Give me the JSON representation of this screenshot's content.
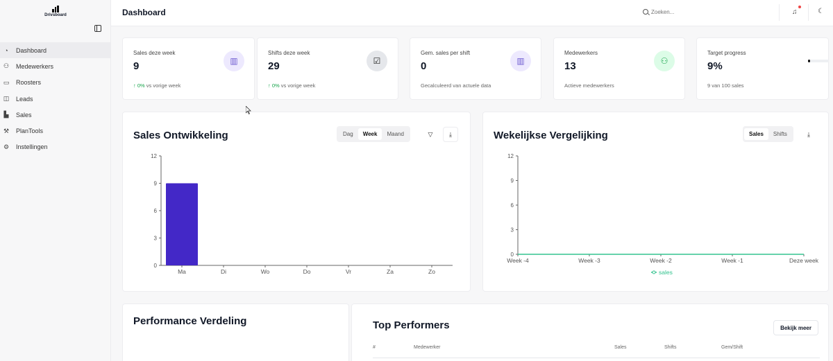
{
  "app": {
    "logo_text": "Drivsboard",
    "page_title": "Dashboard"
  },
  "sidebar": {
    "items": [
      {
        "label": "Dashboard",
        "icon": "dashboard-icon",
        "active": true
      },
      {
        "label": "Medewerkers",
        "icon": "users-icon",
        "active": false
      },
      {
        "label": "Roosters",
        "icon": "calendar-icon",
        "active": false
      },
      {
        "label": "Leads",
        "icon": "book-icon",
        "active": false
      },
      {
        "label": "Sales",
        "icon": "bar-chart-icon",
        "active": false
      },
      {
        "label": "PlanTools",
        "icon": "wrench-icon",
        "active": false
      },
      {
        "label": "Instellingen",
        "icon": "gear-icon",
        "active": false
      }
    ]
  },
  "header": {
    "search_placeholder": "Zoeken..."
  },
  "stats": [
    {
      "label": "Sales deze week",
      "value": "9",
      "sub_pct": "0%",
      "sub_text": "vs vorige week",
      "icon": "bar-chart-icon"
    },
    {
      "label": "Shifts deze week",
      "value": "29",
      "sub_pct": "0%",
      "sub_text": "vs vorige week",
      "icon": "calendar-check-icon"
    },
    {
      "label": "Gem. sales per shift",
      "value": "0",
      "sub_text": "Gecalculeerd van actuele data",
      "icon": "bar-chart-icon"
    },
    {
      "label": "Medewerkers",
      "value": "13",
      "sub_text": "Actieve medewerkers",
      "icon": "users-icon"
    },
    {
      "label": "Target progress",
      "value": "9%",
      "sub_text": "9 van 100 sales",
      "progress": 0.09
    }
  ],
  "sales_panel": {
    "title": "Sales Ontwikkeling",
    "tabs": [
      "Dag",
      "Week",
      "Maand"
    ],
    "active_tab": "Week"
  },
  "weekly_panel": {
    "title": "Wekelijkse Vergelijking",
    "tabs": [
      "Sales",
      "Shifts"
    ],
    "active_tab": "Sales"
  },
  "performance_panel": {
    "title": "Performance Verdeling"
  },
  "top_performers": {
    "title": "Top Performers",
    "button_label": "Bekijk meer",
    "columns": [
      "#",
      "Medewerker",
      "Sales",
      "Shifts",
      "Gem/Shift"
    ]
  },
  "chart_data": [
    {
      "type": "bar",
      "categories": [
        "Ma",
        "Di",
        "Wo",
        "Do",
        "Vr",
        "Za",
        "Zo"
      ],
      "values": [
        9,
        0,
        0,
        0,
        0,
        0,
        0
      ],
      "yticks": [
        "0",
        "3",
        "6",
        "9",
        "12"
      ],
      "ylim": [
        0,
        12
      ],
      "color": "#4328c7"
    },
    {
      "type": "line",
      "categories": [
        "Week -4",
        "Week -3",
        "Week -2",
        "Week -1",
        "Deze week"
      ],
      "series": [
        {
          "name": "sales",
          "values": [
            0,
            0,
            0,
            0,
            0
          ]
        }
      ],
      "yticks": [
        "0",
        "3",
        "6",
        "9",
        "12"
      ],
      "ylim": [
        0,
        12
      ],
      "legend": "bottom",
      "color": "#34c38f"
    }
  ]
}
